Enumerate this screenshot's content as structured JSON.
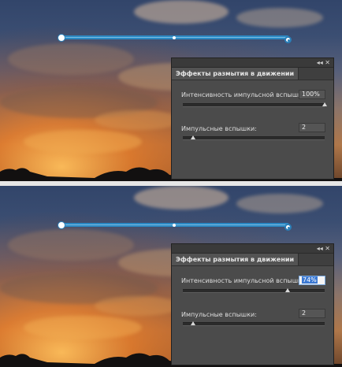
{
  "panel_top": {
    "tab_title": "Эффекты размытия в движении",
    "controls_label": "◂◂ ✕",
    "intensity_label": "Интенсивность импульсной вспышки:",
    "intensity_value": "100%",
    "intensity_level": 1.0,
    "flashes_label": "Импульсные вспышки:",
    "flashes_value": "2",
    "flashes_level": 0.07
  },
  "panel_bottom": {
    "tab_title": "Эффекты размытия в движении",
    "controls_label": "◂◂ ✕",
    "intensity_label": "Интенсивность импульсной вспышки:",
    "intensity_value": "74%",
    "intensity_level": 0.74,
    "flashes_label": "Импульсные вспышки:",
    "flashes_value": "2",
    "flashes_level": 0.07
  },
  "colors": {
    "path_blue": "#2c89c4",
    "panel_bg": "#4b4b4b",
    "selection_blue": "#3a78d2"
  }
}
